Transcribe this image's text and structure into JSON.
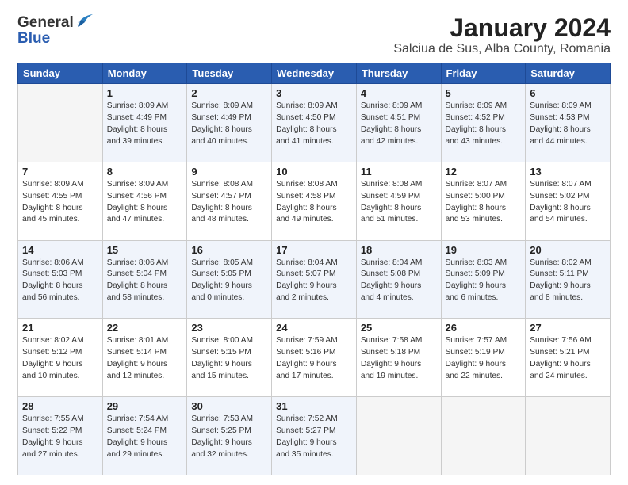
{
  "header": {
    "logo_general": "General",
    "logo_blue": "Blue",
    "title": "January 2024",
    "subtitle": "Salciua de Sus, Alba County, Romania"
  },
  "weekdays": [
    "Sunday",
    "Monday",
    "Tuesday",
    "Wednesday",
    "Thursday",
    "Friday",
    "Saturday"
  ],
  "weeks": [
    [
      {
        "num": "",
        "info": ""
      },
      {
        "num": "1",
        "info": "Sunrise: 8:09 AM\nSunset: 4:49 PM\nDaylight: 8 hours\nand 39 minutes."
      },
      {
        "num": "2",
        "info": "Sunrise: 8:09 AM\nSunset: 4:49 PM\nDaylight: 8 hours\nand 40 minutes."
      },
      {
        "num": "3",
        "info": "Sunrise: 8:09 AM\nSunset: 4:50 PM\nDaylight: 8 hours\nand 41 minutes."
      },
      {
        "num": "4",
        "info": "Sunrise: 8:09 AM\nSunset: 4:51 PM\nDaylight: 8 hours\nand 42 minutes."
      },
      {
        "num": "5",
        "info": "Sunrise: 8:09 AM\nSunset: 4:52 PM\nDaylight: 8 hours\nand 43 minutes."
      },
      {
        "num": "6",
        "info": "Sunrise: 8:09 AM\nSunset: 4:53 PM\nDaylight: 8 hours\nand 44 minutes."
      }
    ],
    [
      {
        "num": "7",
        "info": "Sunrise: 8:09 AM\nSunset: 4:55 PM\nDaylight: 8 hours\nand 45 minutes."
      },
      {
        "num": "8",
        "info": "Sunrise: 8:09 AM\nSunset: 4:56 PM\nDaylight: 8 hours\nand 47 minutes."
      },
      {
        "num": "9",
        "info": "Sunrise: 8:08 AM\nSunset: 4:57 PM\nDaylight: 8 hours\nand 48 minutes."
      },
      {
        "num": "10",
        "info": "Sunrise: 8:08 AM\nSunset: 4:58 PM\nDaylight: 8 hours\nand 49 minutes."
      },
      {
        "num": "11",
        "info": "Sunrise: 8:08 AM\nSunset: 4:59 PM\nDaylight: 8 hours\nand 51 minutes."
      },
      {
        "num": "12",
        "info": "Sunrise: 8:07 AM\nSunset: 5:00 PM\nDaylight: 8 hours\nand 53 minutes."
      },
      {
        "num": "13",
        "info": "Sunrise: 8:07 AM\nSunset: 5:02 PM\nDaylight: 8 hours\nand 54 minutes."
      }
    ],
    [
      {
        "num": "14",
        "info": "Sunrise: 8:06 AM\nSunset: 5:03 PM\nDaylight: 8 hours\nand 56 minutes."
      },
      {
        "num": "15",
        "info": "Sunrise: 8:06 AM\nSunset: 5:04 PM\nDaylight: 8 hours\nand 58 minutes."
      },
      {
        "num": "16",
        "info": "Sunrise: 8:05 AM\nSunset: 5:05 PM\nDaylight: 9 hours\nand 0 minutes."
      },
      {
        "num": "17",
        "info": "Sunrise: 8:04 AM\nSunset: 5:07 PM\nDaylight: 9 hours\nand 2 minutes."
      },
      {
        "num": "18",
        "info": "Sunrise: 8:04 AM\nSunset: 5:08 PM\nDaylight: 9 hours\nand 4 minutes."
      },
      {
        "num": "19",
        "info": "Sunrise: 8:03 AM\nSunset: 5:09 PM\nDaylight: 9 hours\nand 6 minutes."
      },
      {
        "num": "20",
        "info": "Sunrise: 8:02 AM\nSunset: 5:11 PM\nDaylight: 9 hours\nand 8 minutes."
      }
    ],
    [
      {
        "num": "21",
        "info": "Sunrise: 8:02 AM\nSunset: 5:12 PM\nDaylight: 9 hours\nand 10 minutes."
      },
      {
        "num": "22",
        "info": "Sunrise: 8:01 AM\nSunset: 5:14 PM\nDaylight: 9 hours\nand 12 minutes."
      },
      {
        "num": "23",
        "info": "Sunrise: 8:00 AM\nSunset: 5:15 PM\nDaylight: 9 hours\nand 15 minutes."
      },
      {
        "num": "24",
        "info": "Sunrise: 7:59 AM\nSunset: 5:16 PM\nDaylight: 9 hours\nand 17 minutes."
      },
      {
        "num": "25",
        "info": "Sunrise: 7:58 AM\nSunset: 5:18 PM\nDaylight: 9 hours\nand 19 minutes."
      },
      {
        "num": "26",
        "info": "Sunrise: 7:57 AM\nSunset: 5:19 PM\nDaylight: 9 hours\nand 22 minutes."
      },
      {
        "num": "27",
        "info": "Sunrise: 7:56 AM\nSunset: 5:21 PM\nDaylight: 9 hours\nand 24 minutes."
      }
    ],
    [
      {
        "num": "28",
        "info": "Sunrise: 7:55 AM\nSunset: 5:22 PM\nDaylight: 9 hours\nand 27 minutes."
      },
      {
        "num": "29",
        "info": "Sunrise: 7:54 AM\nSunset: 5:24 PM\nDaylight: 9 hours\nand 29 minutes."
      },
      {
        "num": "30",
        "info": "Sunrise: 7:53 AM\nSunset: 5:25 PM\nDaylight: 9 hours\nand 32 minutes."
      },
      {
        "num": "31",
        "info": "Sunrise: 7:52 AM\nSunset: 5:27 PM\nDaylight: 9 hours\nand 35 minutes."
      },
      {
        "num": "",
        "info": ""
      },
      {
        "num": "",
        "info": ""
      },
      {
        "num": "",
        "info": ""
      }
    ]
  ]
}
